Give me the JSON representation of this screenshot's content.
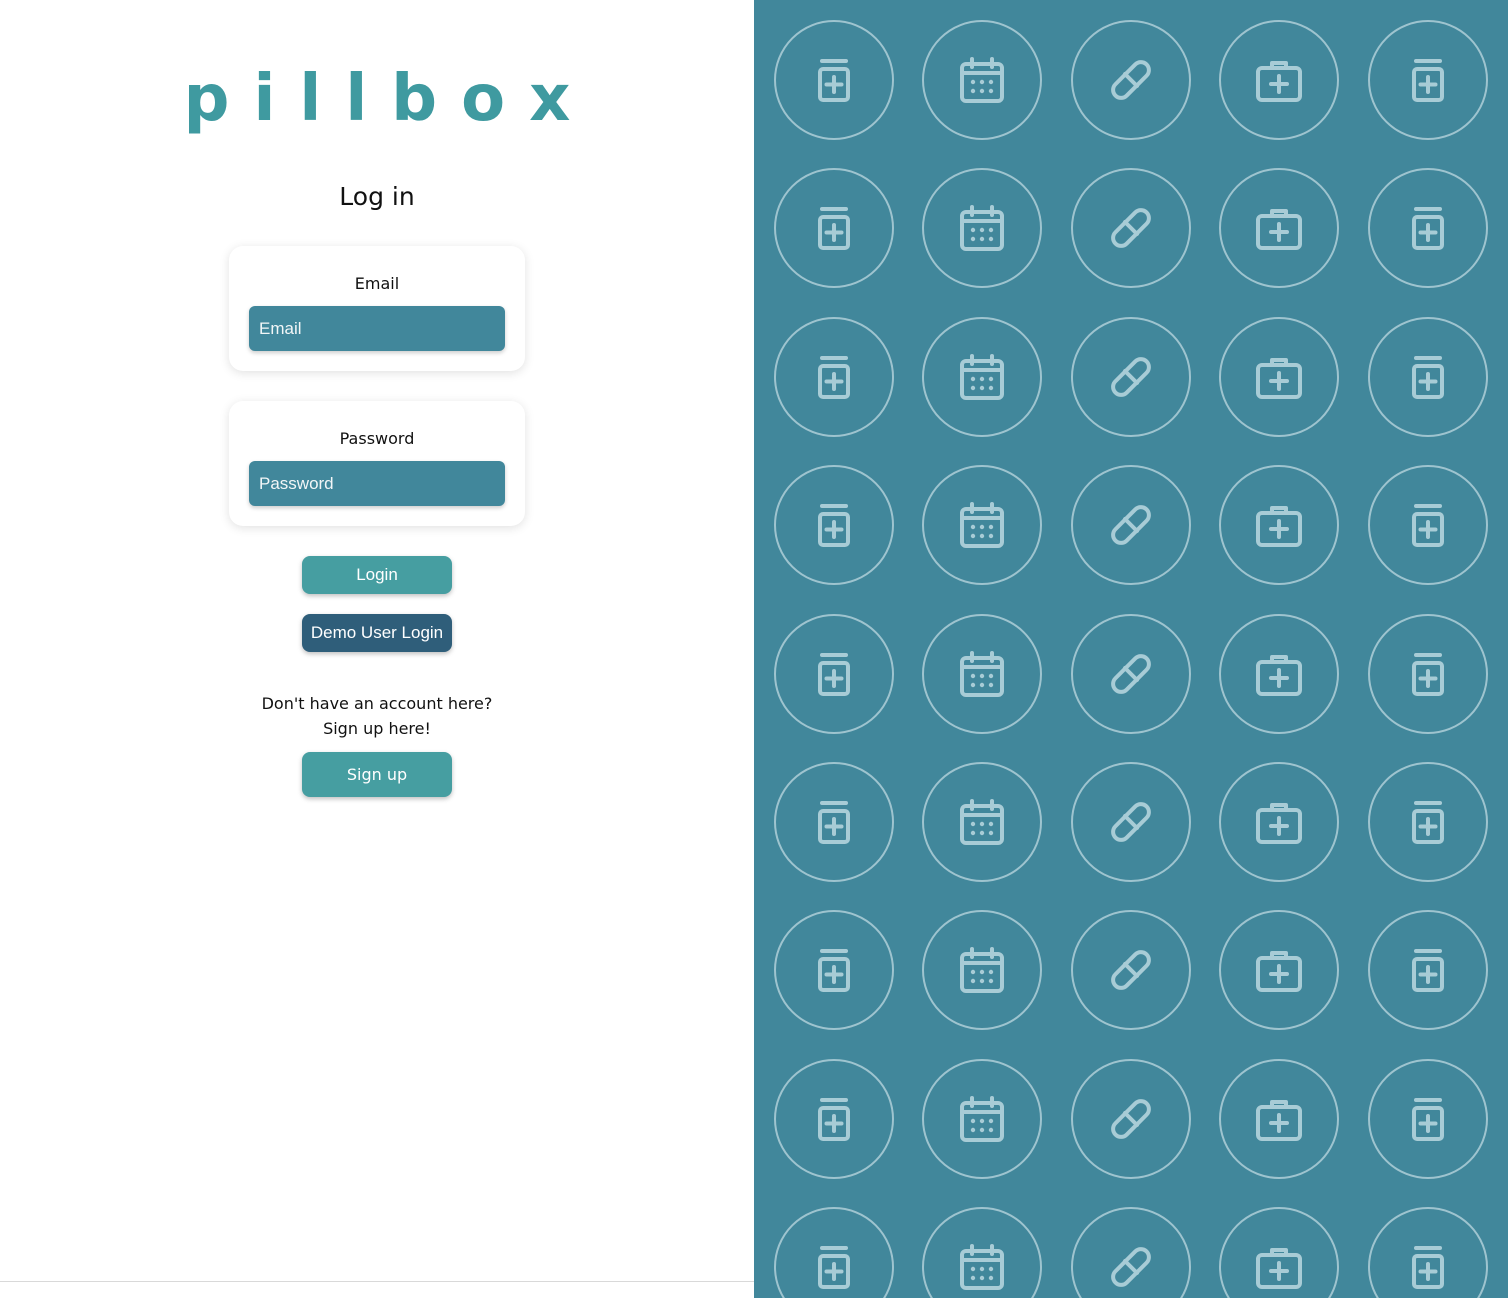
{
  "brand": {
    "logo_text": "pillbox",
    "color": "#3f9aa0"
  },
  "form": {
    "heading": "Log in",
    "email": {
      "label": "Email",
      "placeholder": "Email",
      "value": ""
    },
    "password": {
      "label": "Password",
      "placeholder": "Password",
      "value": ""
    },
    "login_button": "Login",
    "demo_button": "Demo User Login"
  },
  "signup": {
    "prompt_line1": "Don't have an account here?",
    "prompt_line2": "Sign up here!",
    "button": "Sign up"
  },
  "pattern": {
    "background": "#41879b",
    "icon_color": "#a8ccd6",
    "column_icons": [
      "medicine-bottle-icon",
      "calendar-icon",
      "pill-icon",
      "medical-kit-icon",
      "medicine-bottle-icon"
    ]
  }
}
